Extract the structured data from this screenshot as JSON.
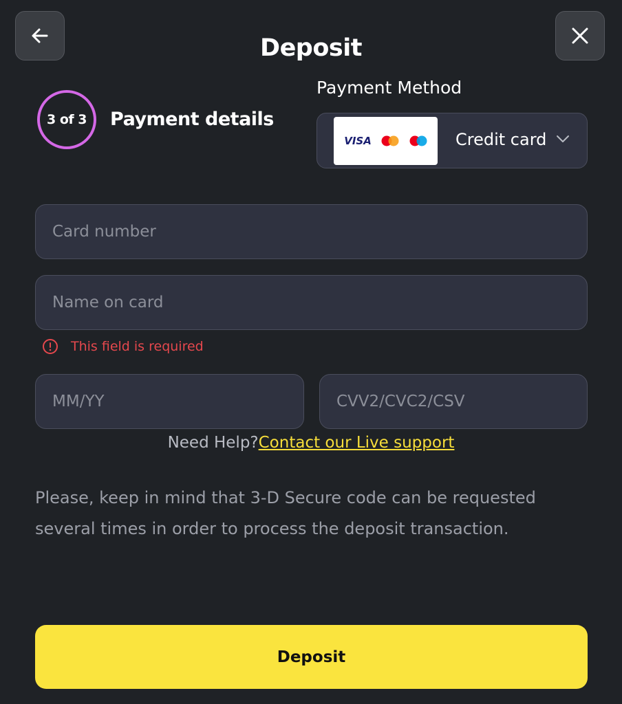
{
  "header": {
    "title": "Deposit",
    "back_icon": "arrow-left-icon",
    "close_icon": "close-icon"
  },
  "step": {
    "indicator": "3 of 3",
    "title": "Payment details",
    "ring_color": "#d468e6"
  },
  "payment_method": {
    "label": "Payment Method",
    "selected": "Credit card",
    "logos": {
      "visa": "VISA"
    }
  },
  "form": {
    "card_number_placeholder": "Card number",
    "name_placeholder": "Name on card",
    "name_error": "This field is required",
    "expiry_placeholder": "MM/YY",
    "cvv_placeholder": "CVV2/CVC2/CSV"
  },
  "help": {
    "prefix": "Need Help?",
    "link": "Contact our Live support"
  },
  "note": "Please, keep in mind that 3-D Secure code can be requested several times in order to process the deposit transaction.",
  "submit": {
    "label": "Deposit"
  },
  "colors": {
    "background": "#1f2226",
    "accent": "#fae43e",
    "error": "#e5484d",
    "link": "#f7de3a"
  }
}
